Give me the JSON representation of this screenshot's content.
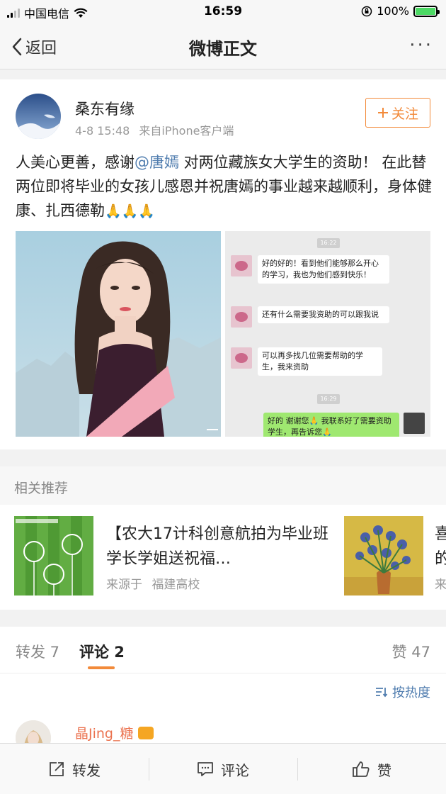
{
  "status": {
    "carrier": "中国电信",
    "time": "16:59",
    "battery": "100%"
  },
  "nav": {
    "back_label": "返回",
    "title": "微博正文",
    "more": "···"
  },
  "post": {
    "username": "桑东有缘",
    "time": "4-8 15:48",
    "source": "来自iPhone客户端",
    "follow_label": "关注",
    "text_before": "人美心更善，感谢",
    "mention": "@唐嫣",
    "text_after": " 对两位藏族女大学生的资助！ 在此替两位即将毕业的女孩儿感恩并祝唐嫣的事业越来越顺利，身体健康、扎西德勒",
    "emoji": "🙏🙏🙏",
    "chat": {
      "time1": "16:22",
      "msg1": "好的好的！看到他们能够那么开心的学习，我也为他们感到快乐！",
      "msg2": "还有什么需要我资助的可以跟我说",
      "msg3": "可以再多找几位需要帮助的学生，我来资助",
      "time2": "16:29",
      "msg4": "好的 谢谢您🙏 我联系好了需要资助学生，再告诉您🙏"
    }
  },
  "recommend": {
    "header": "相关推荐",
    "items": [
      {
        "title": "【农大17计科创意航拍为毕业班学长学姐送祝福…",
        "source_prefix": "来源于",
        "source": "福建高校"
      },
      {
        "title_peek": "喜",
        "title_peek2": "的",
        "source_peek": "来"
      }
    ]
  },
  "tabs": {
    "repost": "转发 7",
    "comment": "评论 2",
    "like": "赞 47",
    "active": "comment"
  },
  "sort_label": "按热度",
  "comment": {
    "username": "晶Jing_糖"
  },
  "bottom": {
    "repost": "转发",
    "comment": "评论",
    "like": "赞"
  },
  "colors": {
    "accent": "#f28a3a",
    "link": "#507daf",
    "comment_user": "#eb7350"
  }
}
